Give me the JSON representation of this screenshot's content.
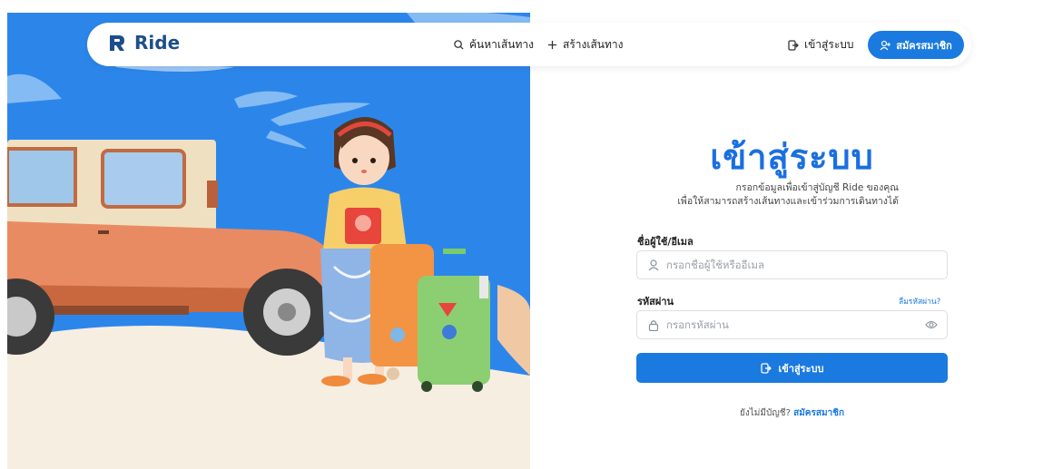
{
  "navbar": {
    "brand": "Ride",
    "links": [
      {
        "label": "ค้นหาเส้นทาง",
        "icon": "search-icon"
      },
      {
        "label": "สร้างเส้นทาง",
        "icon": "plus-icon"
      }
    ],
    "login_label": "เข้าสู่ระบบ",
    "signup_label": "สมัครสมาชิก"
  },
  "form": {
    "title": "เข้าสู่ระบบ",
    "subtitle_line1": "กรอกข้อมูลเพื่อเข้าสู่บัญชี Ride ของคุณ",
    "subtitle_line2": "เพื่อให้สามารถสร้างเส้นทางและเข้าร่วมการเดินทางได้",
    "username_label": "ชื่อผู้ใช้/อีเมล",
    "username_placeholder": "กรอกชื่อผู้ใช้หรืออีเมล",
    "password_label": "รหัสผ่าน",
    "forgot_label": "ลืมรหัสผ่าน?",
    "password_placeholder": "กรอกรหัสผ่าน",
    "submit_label": "เข้าสู่ระบบ",
    "no_account_text": "ยังไม่มีบัญชี?",
    "signup_link": "สมัครสมาชิก"
  },
  "colors": {
    "primary": "#1a7ae0",
    "title": "#1a6fe0",
    "sky": "#2c86ea",
    "brand": "#1d4e89"
  }
}
